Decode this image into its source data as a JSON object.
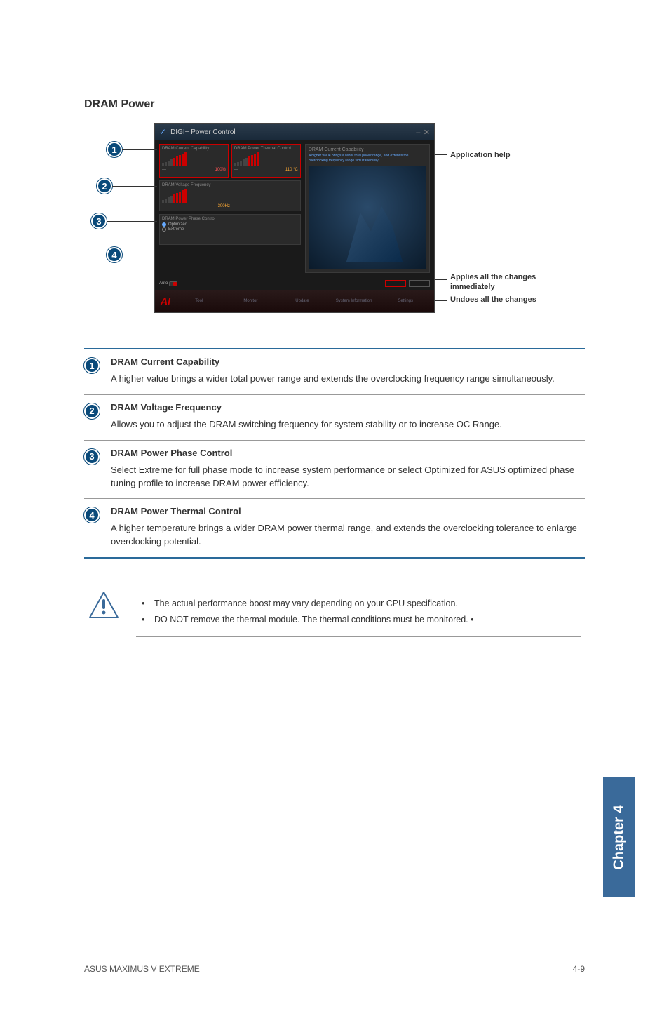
{
  "section_title": "DRAM Power",
  "screenshot": {
    "window_title": "DIGI+ Power Control",
    "tiles": {
      "t1": {
        "label": "DRAM Current Capability",
        "value": "100%"
      },
      "t2": {
        "label": "DRAM Power Thermal Control",
        "value": "110 °C"
      },
      "t3": {
        "label": "DRAM Voltage Frequency",
        "value": "300Hz"
      },
      "t4": {
        "label": "DRAM Power Phase Control",
        "opt1": "Optimized",
        "opt2": "Extreme"
      }
    },
    "help": {
      "title": "DRAM Current Capability",
      "text": "A higher value brings a wider total power range, and extends the overclocking frequency range simultaneously."
    },
    "auto_label": "Auto",
    "bottom_tabs": [
      "Tool",
      "Monitor",
      "Update",
      "System Information",
      "Settings"
    ]
  },
  "markers": [
    "1",
    "2",
    "3",
    "4"
  ],
  "annotations": {
    "help": "Application help",
    "apply": "Applies all the changes immediately",
    "undo": "Undoes all the changes"
  },
  "items": [
    {
      "num": "1",
      "title": "DRAM Current Capability",
      "text": "A higher value brings a wider total power range and extends the overclocking frequency range simultaneously."
    },
    {
      "num": "2",
      "title": "DRAM Voltage Frequency",
      "text": "Allows you to adjust the DRAM switching frequency for system stability or to increase OC Range."
    },
    {
      "num": "3",
      "title": "DRAM Power Phase Control",
      "text": "Select Extreme for full phase mode to increase system performance or select Optimized for ASUS optimized phase tuning profile to increase DRAM power efficiency."
    },
    {
      "num": "4",
      "title": "DRAM Power Thermal Control",
      "text": "A higher temperature brings a wider DRAM power thermal range, and extends the overclocking tolerance to enlarge overclocking potential."
    }
  ],
  "warnings": [
    "The actual performance boost may vary depending on your CPU specification.",
    "DO NOT remove the thermal module. The thermal conditions must be monitored. •"
  ],
  "side_tab": "Chapter 4",
  "footer": {
    "left": "ASUS MAXIMUS V EXTREME",
    "right": "4-9"
  }
}
